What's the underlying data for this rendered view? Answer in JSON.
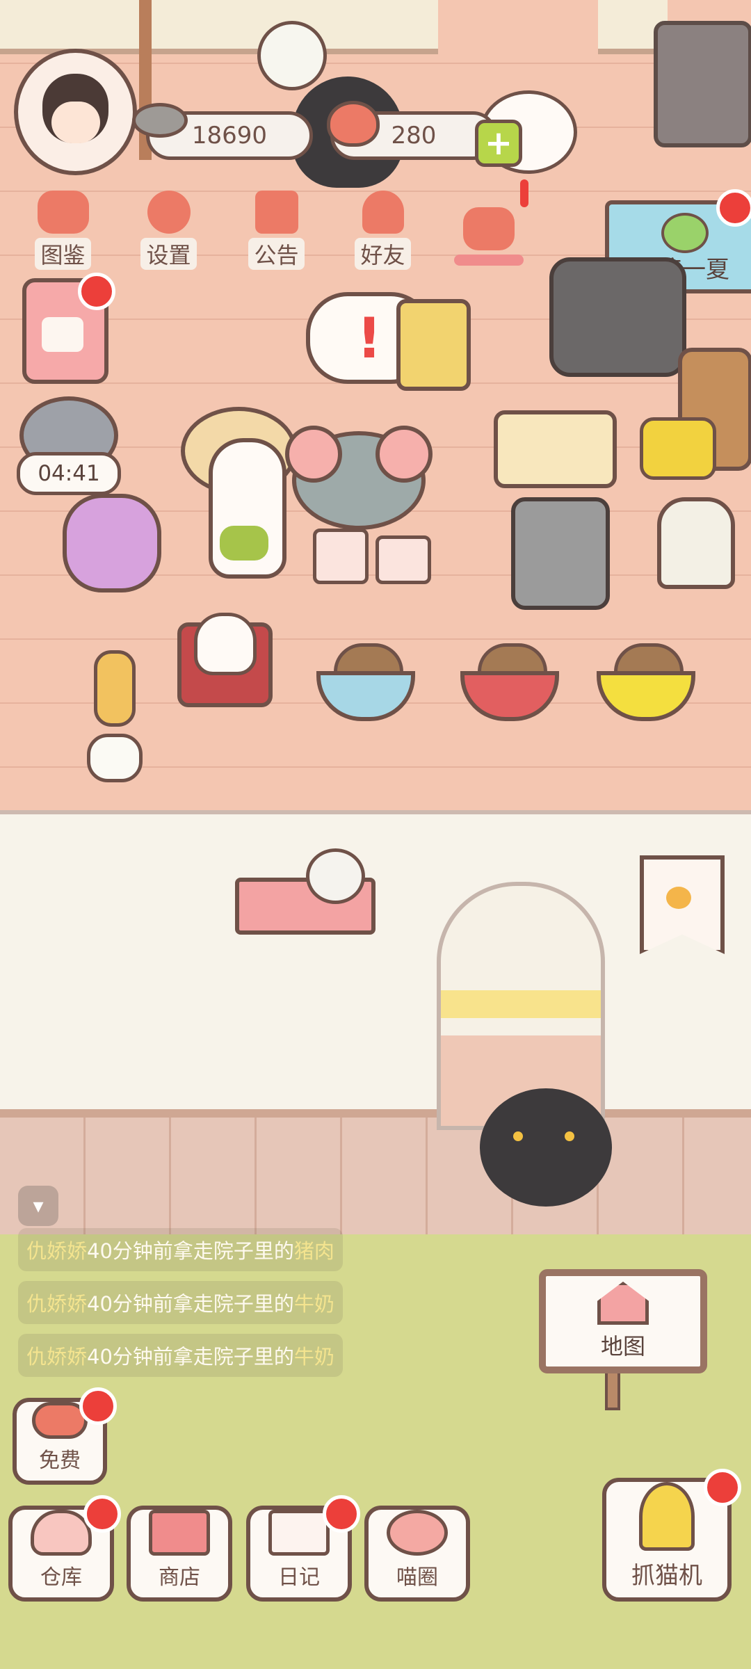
{
  "currency": {
    "fish_coins": "18690",
    "hearts": "280"
  },
  "menu": [
    {
      "label": "图鉴",
      "icon": "cat-book-icon"
    },
    {
      "label": "设置",
      "icon": "gear-icon"
    },
    {
      "label": "公告",
      "icon": "gift-icon"
    },
    {
      "label": "好友",
      "icon": "friends-icon"
    },
    {
      "label": "",
      "icon": "heart-mail-icon"
    }
  ],
  "event_banner": {
    "label": "清凉一夏"
  },
  "timer": {
    "value": "04:41"
  },
  "messages": [
    {
      "name": "仇娇娇",
      "text": "40分钟前拿走院子里的",
      "item": "猪肉"
    },
    {
      "name": "仇娇娇",
      "text": "40分钟前拿走院子里的",
      "item": "牛奶"
    },
    {
      "name": "仇娇娇",
      "text": "40分钟前拿走院子里的",
      "item": "牛奶"
    }
  ],
  "map_sign": {
    "label": "地图"
  },
  "free_button": {
    "label": "免费"
  },
  "bottom_nav": [
    {
      "label": "仓库",
      "icon": "storage-icon",
      "badge": true
    },
    {
      "label": "商店",
      "icon": "shop-icon",
      "badge": false
    },
    {
      "label": "日记",
      "icon": "diary-icon",
      "badge": true
    },
    {
      "label": "喵圈",
      "icon": "planet-cat-icon",
      "badge": false
    }
  ],
  "claw_machine": {
    "label": "抓猫机"
  },
  "colors": {
    "outline": "#6f5148",
    "badge": "#ec3f3a",
    "accent_pink": "#ec7a66",
    "highlight_yellow": "#f4e48f",
    "yard_green": "#d5d98f"
  }
}
